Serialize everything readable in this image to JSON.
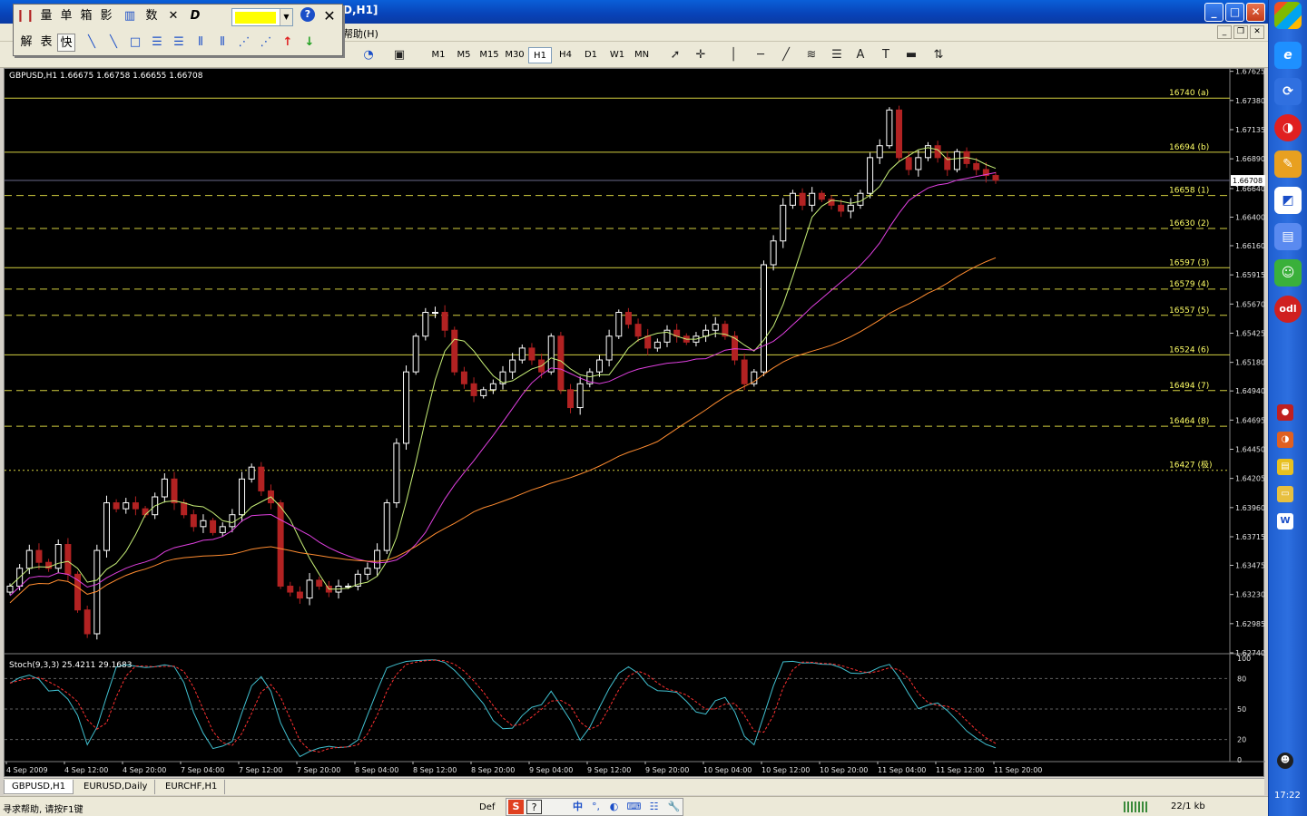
{
  "window": {
    "title": "D,H1]"
  },
  "menubar": {
    "help_label": "帮助(H)"
  },
  "float_toolbar": {
    "row1": [
      "量",
      "单",
      "箱",
      "影",
      "数"
    ],
    "row2": [
      "解",
      "表",
      "快"
    ],
    "colors": {
      "swatch": "#ffff00"
    }
  },
  "timeframes": [
    "M1",
    "M5",
    "M15",
    "M30",
    "H1",
    "H4",
    "D1",
    "W1",
    "MN"
  ],
  "active_timeframe": "H1",
  "chart": {
    "symbol_info": "GBPUSD,H1  1.66675 1.66758 1.66655 1.66708",
    "stoch_info": "Stoch(9,3,3) 25.4211 29.1683",
    "current_price": "1.66708",
    "price_ticks": [
      "1.67625",
      "1.67380",
      "1.67135",
      "1.66890",
      "1.66640",
      "1.66400",
      "1.66160",
      "1.65915",
      "1.65670",
      "1.65425",
      "1.65180",
      "1.64940",
      "1.64695",
      "1.64450",
      "1.64205",
      "1.63960",
      "1.63715",
      "1.63475",
      "1.63230",
      "1.62985",
      "1.62740"
    ],
    "stoch_ticks": [
      "100",
      "80",
      "50",
      "20",
      "0"
    ],
    "time_labels": [
      "4 Sep 2009",
      "4 Sep 12:00",
      "4 Sep 20:00",
      "7 Sep 04:00",
      "7 Sep 12:00",
      "7 Sep 20:00",
      "8 Sep 04:00",
      "8 Sep 12:00",
      "8 Sep 20:00",
      "9 Sep 04:00",
      "9 Sep 12:00",
      "9 Sep 20:00",
      "10 Sep 04:00",
      "10 Sep 12:00",
      "10 Sep 20:00",
      "11 Sep 04:00",
      "11 Sep 12:00",
      "11 Sep 20:00"
    ],
    "levels": [
      {
        "label": "16740 (a)",
        "price": 1.674,
        "style": "solid"
      },
      {
        "label": "16694 (b)",
        "price": 1.66945,
        "style": "solid"
      },
      {
        "label": "16658 (1)",
        "price": 1.66582,
        "style": "dashed"
      },
      {
        "label": "16630 (2)",
        "price": 1.66305,
        "style": "dashed"
      },
      {
        "label": "16597 (3)",
        "price": 1.65975,
        "style": "solid"
      },
      {
        "label": "16579 (4)",
        "price": 1.65795,
        "style": "dashed"
      },
      {
        "label": "16557 (5)",
        "price": 1.65575,
        "style": "dashed"
      },
      {
        "label": "16524 (6)",
        "price": 1.65243,
        "style": "solid"
      },
      {
        "label": "16494 (7)",
        "price": 1.64943,
        "style": "dashed"
      },
      {
        "label": "16464 (8)",
        "price": 1.64643,
        "style": "dashed"
      },
      {
        "label": "16427 (极)",
        "price": 1.64273,
        "style": "dotted"
      }
    ],
    "colors": {
      "up_candle": "#ffffff",
      "down_candle": "#b22222",
      "level_line": "#d4d040",
      "level_text": "#ffff66",
      "ma_fast": "#c8f078",
      "ma_mid": "#e040e0",
      "ma_slow": "#ff8c30",
      "stoch_main": "#40c0d0",
      "stoch_signal": "#ff3030"
    }
  },
  "tabs": [
    "GBPUSD,H1",
    "EURUSD,Daily",
    "EURCHF,H1"
  ],
  "active_tab": "GBPUSD,H1",
  "status": {
    "help": "寻求帮助, 请按F1键",
    "def": "Def",
    "kb": "22/1 kb"
  },
  "ime": {
    "mode": "中"
  },
  "clock": "17:22",
  "chart_data": {
    "type": "candlestick",
    "symbol": "GBPUSD",
    "timeframe": "H1",
    "ylim": [
      1.6274,
      1.6763
    ],
    "close_approx": [
      1.633,
      1.6345,
      1.636,
      1.635,
      1.6345,
      1.6365,
      1.634,
      1.631,
      1.629,
      1.636,
      1.64,
      1.6395,
      1.64,
      1.6395,
      1.639,
      1.6405,
      1.642,
      1.64,
      1.639,
      1.638,
      1.6385,
      1.6375,
      1.638,
      1.639,
      1.642,
      1.643,
      1.641,
      1.64,
      1.633,
      1.6325,
      1.632,
      1.6335,
      1.633,
      1.6325,
      1.633,
      1.633,
      1.634,
      1.6345,
      1.636,
      1.64,
      1.645,
      1.651,
      1.654,
      1.656,
      1.656,
      1.6545,
      1.651,
      1.65,
      1.649,
      1.6495,
      1.65,
      1.651,
      1.652,
      1.653,
      1.652,
      1.651,
      1.654,
      1.6495,
      1.648,
      1.65,
      1.651,
      1.652,
      1.654,
      1.656,
      1.655,
      1.654,
      1.653,
      1.6535,
      1.6545,
      1.654,
      1.6535,
      1.654,
      1.6545,
      1.655,
      1.654,
      1.652,
      1.65,
      1.651,
      1.66,
      1.662,
      1.665,
      1.666,
      1.665,
      1.666,
      1.6655,
      1.665,
      1.6645,
      1.665,
      1.666,
      1.669,
      1.67,
      1.673,
      1.669,
      1.668,
      1.669,
      1.67,
      1.669,
      1.668,
      1.6695,
      1.6685,
      1.668,
      1.6675,
      1.6671
    ]
  }
}
